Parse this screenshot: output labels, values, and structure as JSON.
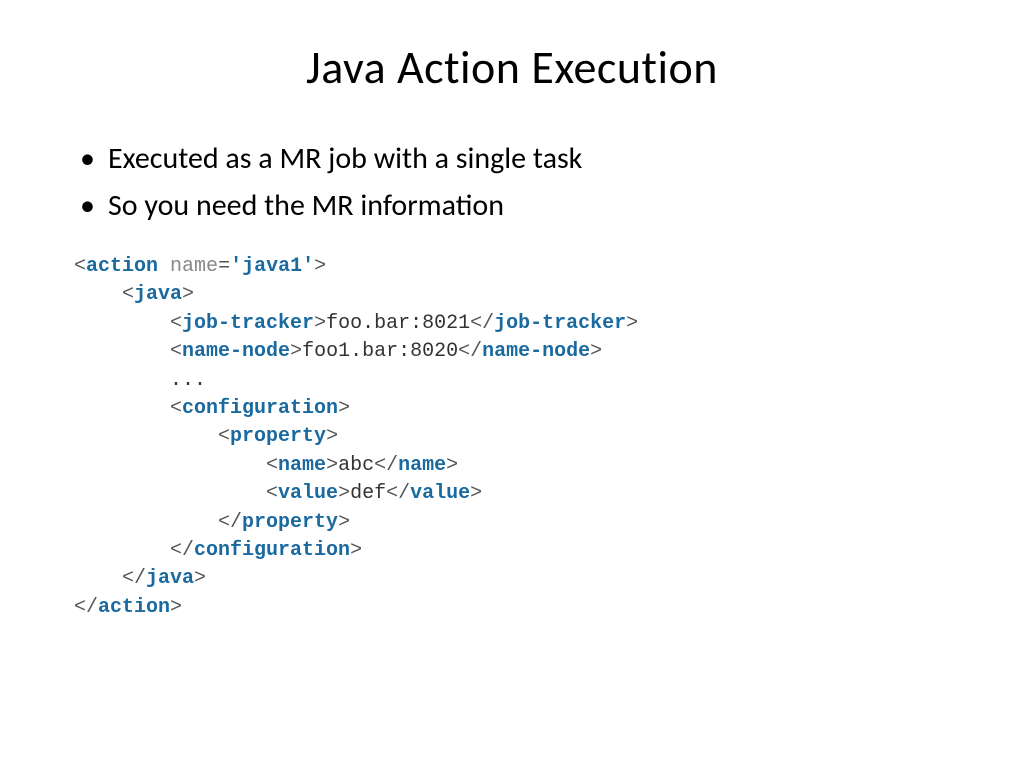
{
  "title": "Java Action Execution",
  "bullets": [
    "Executed as a MR job with a single task",
    "So you need the MR information"
  ],
  "code": {
    "tags": {
      "action": "action",
      "java": "java",
      "job_tracker": "job-tracker",
      "name_node": "name-node",
      "configuration": "configuration",
      "property": "property",
      "name": "name",
      "value": "value"
    },
    "attrs": {
      "name_attr": "name"
    },
    "strings": {
      "action_name": "'java1'"
    },
    "text": {
      "job_tracker": "foo.bar:8021",
      "name_node": "foo1.bar:8020",
      "ellipsis": "...",
      "prop_name": "abc",
      "prop_value": "def"
    }
  }
}
